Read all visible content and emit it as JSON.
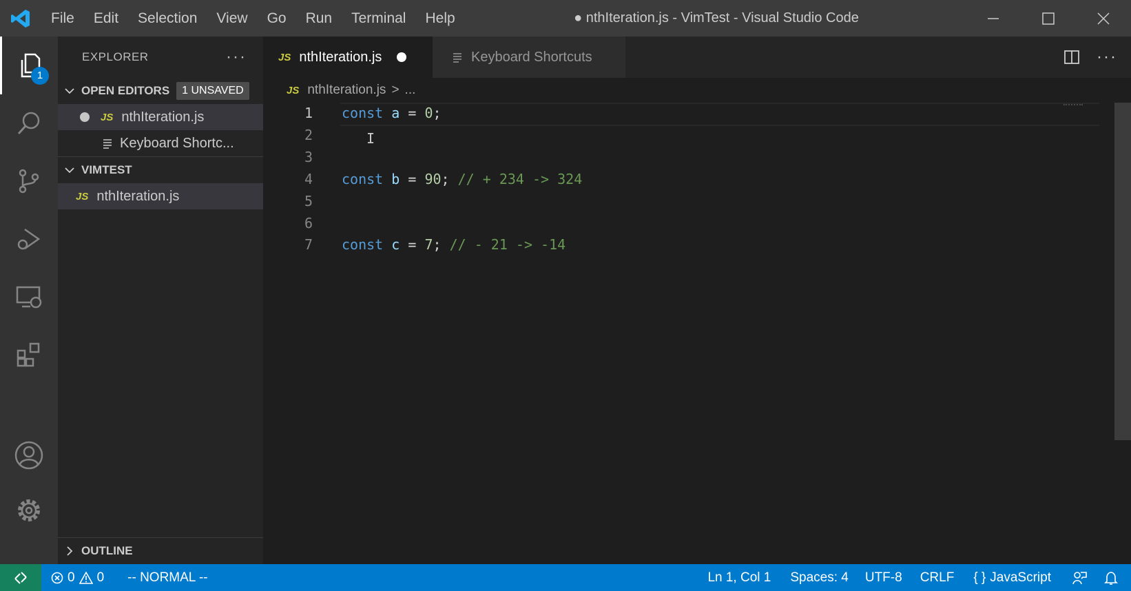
{
  "window": {
    "title": "● nthIteration.js - VimTest - Visual Studio Code",
    "menu": [
      "File",
      "Edit",
      "Selection",
      "View",
      "Go",
      "Run",
      "Terminal",
      "Help"
    ]
  },
  "activity_bar": {
    "explorer_badge": "1",
    "items": [
      "explorer-icon",
      "search-icon",
      "source-control-icon",
      "run-debug-icon",
      "remote-explorer-icon",
      "extensions-icon",
      "accounts-icon",
      "manage-gear-icon"
    ]
  },
  "sidebar": {
    "title": "EXPLORER",
    "open_editors": {
      "label": "OPEN EDITORS",
      "badge": "1 UNSAVED",
      "items": [
        {
          "icon": "JS",
          "label": "nthIteration.js",
          "dirty": true
        },
        {
          "icon": "keyboard-shortcuts-icon",
          "label": "Keyboard Shortc..."
        }
      ]
    },
    "folder": {
      "label": "VIMTEST",
      "items": [
        {
          "icon": "JS",
          "label": "nthIteration.js"
        }
      ]
    },
    "outline": {
      "label": "OUTLINE"
    }
  },
  "tabs": [
    {
      "icon": "JS",
      "label": "nthIteration.js",
      "active": true,
      "dirty": true
    },
    {
      "icon": "keyboard-shortcuts-icon",
      "label": "Keyboard Shortcuts",
      "active": false
    }
  ],
  "breadcrumb": {
    "icon": "JS",
    "file": "nthIteration.js",
    "separator": ">",
    "rest": "..."
  },
  "editor": {
    "lines": [
      {
        "n": "1",
        "kw": "const",
        "var": "a",
        "eq": " = ",
        "num": "0",
        "semi": ";",
        "comment": ""
      },
      {
        "n": "2"
      },
      {
        "n": "3"
      },
      {
        "n": "4",
        "kw": "const",
        "var": "b",
        "eq": " = ",
        "num": "90",
        "semi": ";",
        "comment": " // + 234 -> 324"
      },
      {
        "n": "5"
      },
      {
        "n": "6"
      },
      {
        "n": "7",
        "kw": "const",
        "var": "c",
        "eq": " = ",
        "num": "7",
        "semi": ";",
        "comment": " // - 21 -> -14"
      }
    ],
    "cursor_glyph": "I"
  },
  "status": {
    "errors": "0",
    "warnings": "0",
    "vim_mode": "-- NORMAL --",
    "position": "Ln 1, Col 1",
    "indent": "Spaces: 4",
    "encoding": "UTF-8",
    "eol": "CRLF",
    "language": "JavaScript",
    "language_icon": "{ }"
  },
  "colors": {
    "statusbar": "#007acc",
    "remote": "#16825d",
    "keyword": "#569cd6",
    "variable": "#9cdcfe",
    "number": "#b5cea8",
    "comment": "#6a9955",
    "js_icon": "#cbcb41"
  }
}
